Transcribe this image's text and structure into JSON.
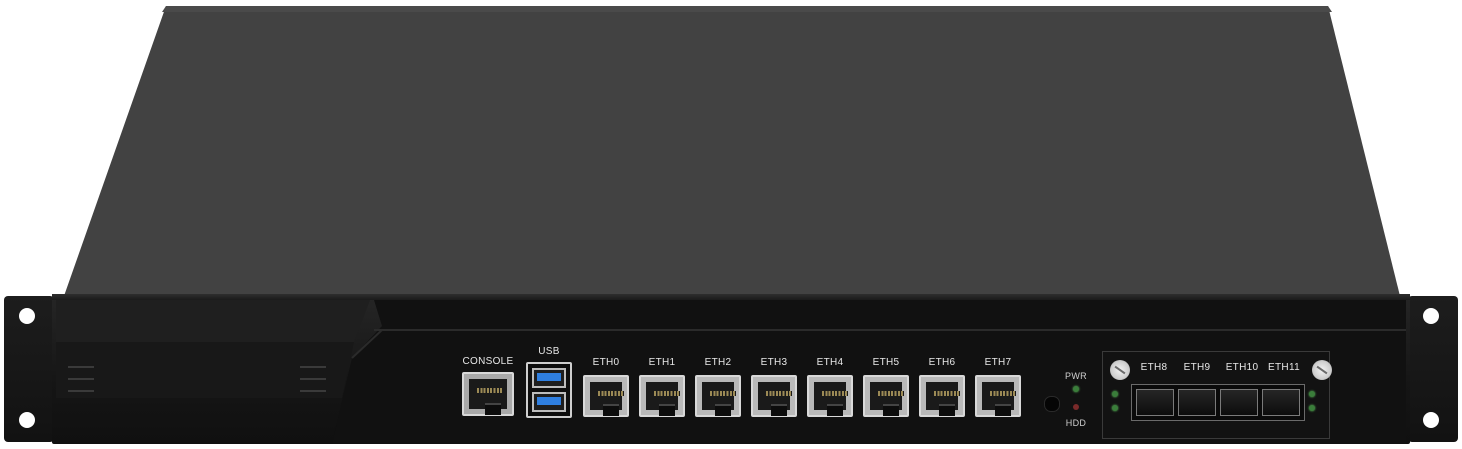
{
  "device": {
    "console_label": "CONSOLE",
    "usb_label": "USB",
    "eth_ports": [
      "ETH0",
      "ETH1",
      "ETH2",
      "ETH3",
      "ETH4",
      "ETH5",
      "ETH6",
      "ETH7"
    ],
    "sfp_ports": [
      "ETH8",
      "ETH9",
      "ETH10",
      "ETH11"
    ],
    "led_labels": {
      "power": "PWR",
      "hdd": "HDD"
    }
  },
  "colors": {
    "chassis": "#404040",
    "front_panel": "#151515",
    "port_metal": "#b9b9b9",
    "usb_blue": "#2f7fe0",
    "led_green": "#3a7d3a"
  }
}
